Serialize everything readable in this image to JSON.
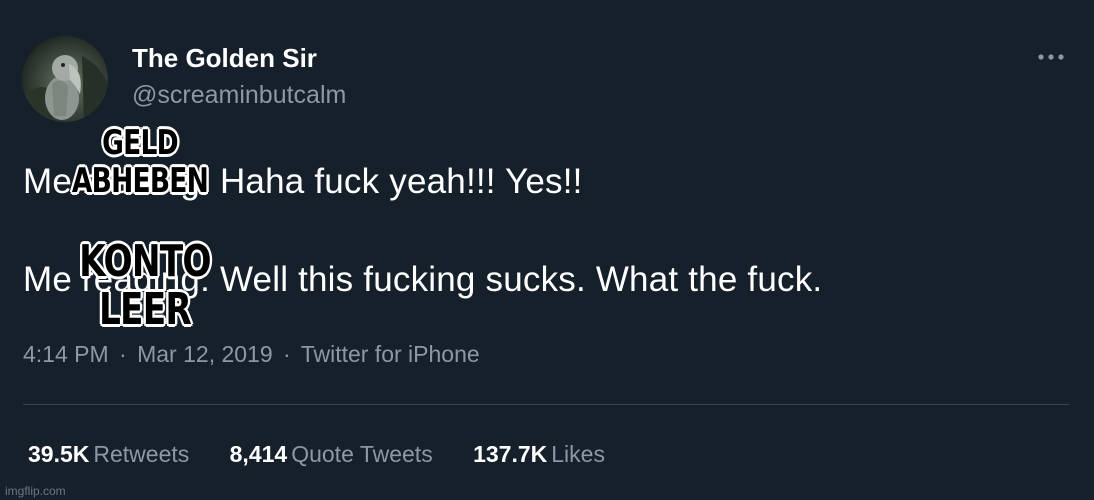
{
  "tweet": {
    "display_name": "The Golden Sir",
    "handle": "@screaminbutcalm",
    "line_1": "Me reading: Haha fuck yeah!!! Yes!!",
    "line_2": "Me reading: Well this fucking sucks. What the fuck.",
    "time": "4:14 PM",
    "date": "Mar 12, 2019",
    "source": "Twitter for iPhone",
    "separator": "·",
    "more_icon": "more-horizontal-icon",
    "avatar_icon": "shoebill-avatar"
  },
  "stats": [
    {
      "value": "39.5K",
      "label": "Retweets"
    },
    {
      "value": "8,414",
      "label": "Quote Tweets"
    },
    {
      "value": "137.7K",
      "label": "Likes"
    }
  ],
  "captions": {
    "caption_1": [
      "GELD",
      "ABHEBEN"
    ],
    "caption_2": [
      "KONTO",
      "LEER"
    ]
  },
  "watermark": "imgflip.com",
  "colors": {
    "background": "#15202b",
    "primary_text": "#ffffff",
    "secondary_text": "#8b98a5",
    "divider": "#38444d"
  }
}
